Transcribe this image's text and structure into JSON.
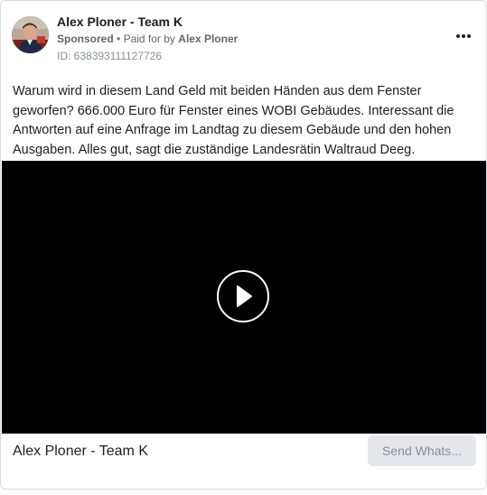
{
  "ad": {
    "page_name": "Alex Ploner - Team K",
    "sponsored_label": "Sponsored",
    "separator": "•",
    "paid_for_prefix": "Paid for by",
    "paid_for_name": "Alex Ploner",
    "ad_id": "ID: 638393111127726",
    "body_text": "Warum wird in diesem Land Geld mit beiden Händen aus dem Fenster geworfen? 666.000 Euro für Fenster eines WOBI Gebäudes. Interessant die Antworten auf eine Anfrage im Landtag zu diesem Gebäude und den hohen Ausgaben. Alles gut, sagt die zuständige Landesrätin Waltraud Deeg.",
    "footer_name": "Alex Ploner - Team K",
    "cta_label": "Send Whats..."
  },
  "icons": {
    "more": "more-options-icon",
    "play": "play-icon"
  }
}
